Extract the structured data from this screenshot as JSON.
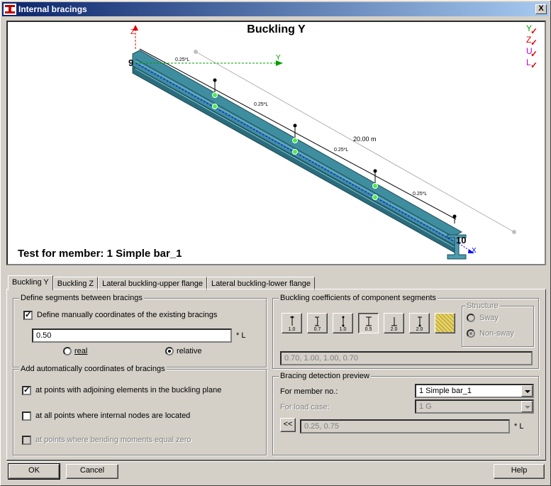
{
  "window": {
    "title": "Internal bracings",
    "close_label": "X"
  },
  "view": {
    "title": "Buckling Y",
    "member_caption": "Test for member: 1 Simple bar_1",
    "node_start": "9",
    "node_end": "10",
    "axis_labels": {
      "z": "Z",
      "y": "Y",
      "x": "X"
    },
    "length_label": "20.00  m",
    "segment_labels": [
      "0.25*L",
      "0.25*L",
      "0.25*L",
      "0.25*L"
    ],
    "legend": [
      {
        "letter": "Y",
        "color": "#00a000"
      },
      {
        "letter": "Z",
        "color": "#e00000"
      },
      {
        "letter": "U",
        "color": "#c000c0"
      },
      {
        "letter": "L",
        "color": "#c000c0"
      }
    ],
    "colors": {
      "beam": "#3f8ea0",
      "beam_dark": "#2a6c7c",
      "bracing_point": "#44ee44"
    }
  },
  "tabs": [
    {
      "label": "Buckling Y",
      "active": true
    },
    {
      "label": "Buckling Z",
      "active": false
    },
    {
      "label": "Lateral buckling-upper flange",
      "active": false
    },
    {
      "label": "Lateral buckling-lower flange",
      "active": false
    }
  ],
  "segments": {
    "group_label": "Define segments between bracings",
    "manual_checkbox_label": "Define manually coordinates of the existing bracings",
    "manual_checked": true,
    "coordinates_value": "0.50",
    "coordinates_unit": "* L",
    "radio_real": "real",
    "radio_relative": "relative",
    "selected": "relative"
  },
  "auto": {
    "group_label": "Add automatically coordinates of bracings",
    "options": [
      {
        "label": "at points with adjoining elements in the buckling plane",
        "checked": true,
        "enabled": true
      },
      {
        "label": "at all points where internal nodes are located",
        "checked": false,
        "enabled": true
      },
      {
        "label": "at points where bending moments equal zero",
        "checked": false,
        "enabled": false
      }
    ]
  },
  "coefficients": {
    "group_label": "Buckling coefficients of component segments",
    "buttons": [
      "1.0",
      "0.7",
      "1.0",
      "0.5",
      "2.0",
      "2.0"
    ],
    "values_field": "0.70, 1.00, 1.00, 0.70",
    "structure": {
      "label": "Structure",
      "sway": "Sway",
      "non_sway": "Non-sway",
      "selected": "non_sway"
    }
  },
  "preview": {
    "group_label": "Bracing detection preview",
    "member_label": "For member no.:",
    "member_value": "1  Simple bar_1",
    "loadcase_label": "For load case:",
    "loadcase_value": "1  G",
    "copy_button": "<<",
    "coords_value": "0.25, 0.75",
    "coords_unit": "* L"
  },
  "buttons": {
    "ok": "OK",
    "cancel": "Cancel",
    "help": "Help"
  }
}
